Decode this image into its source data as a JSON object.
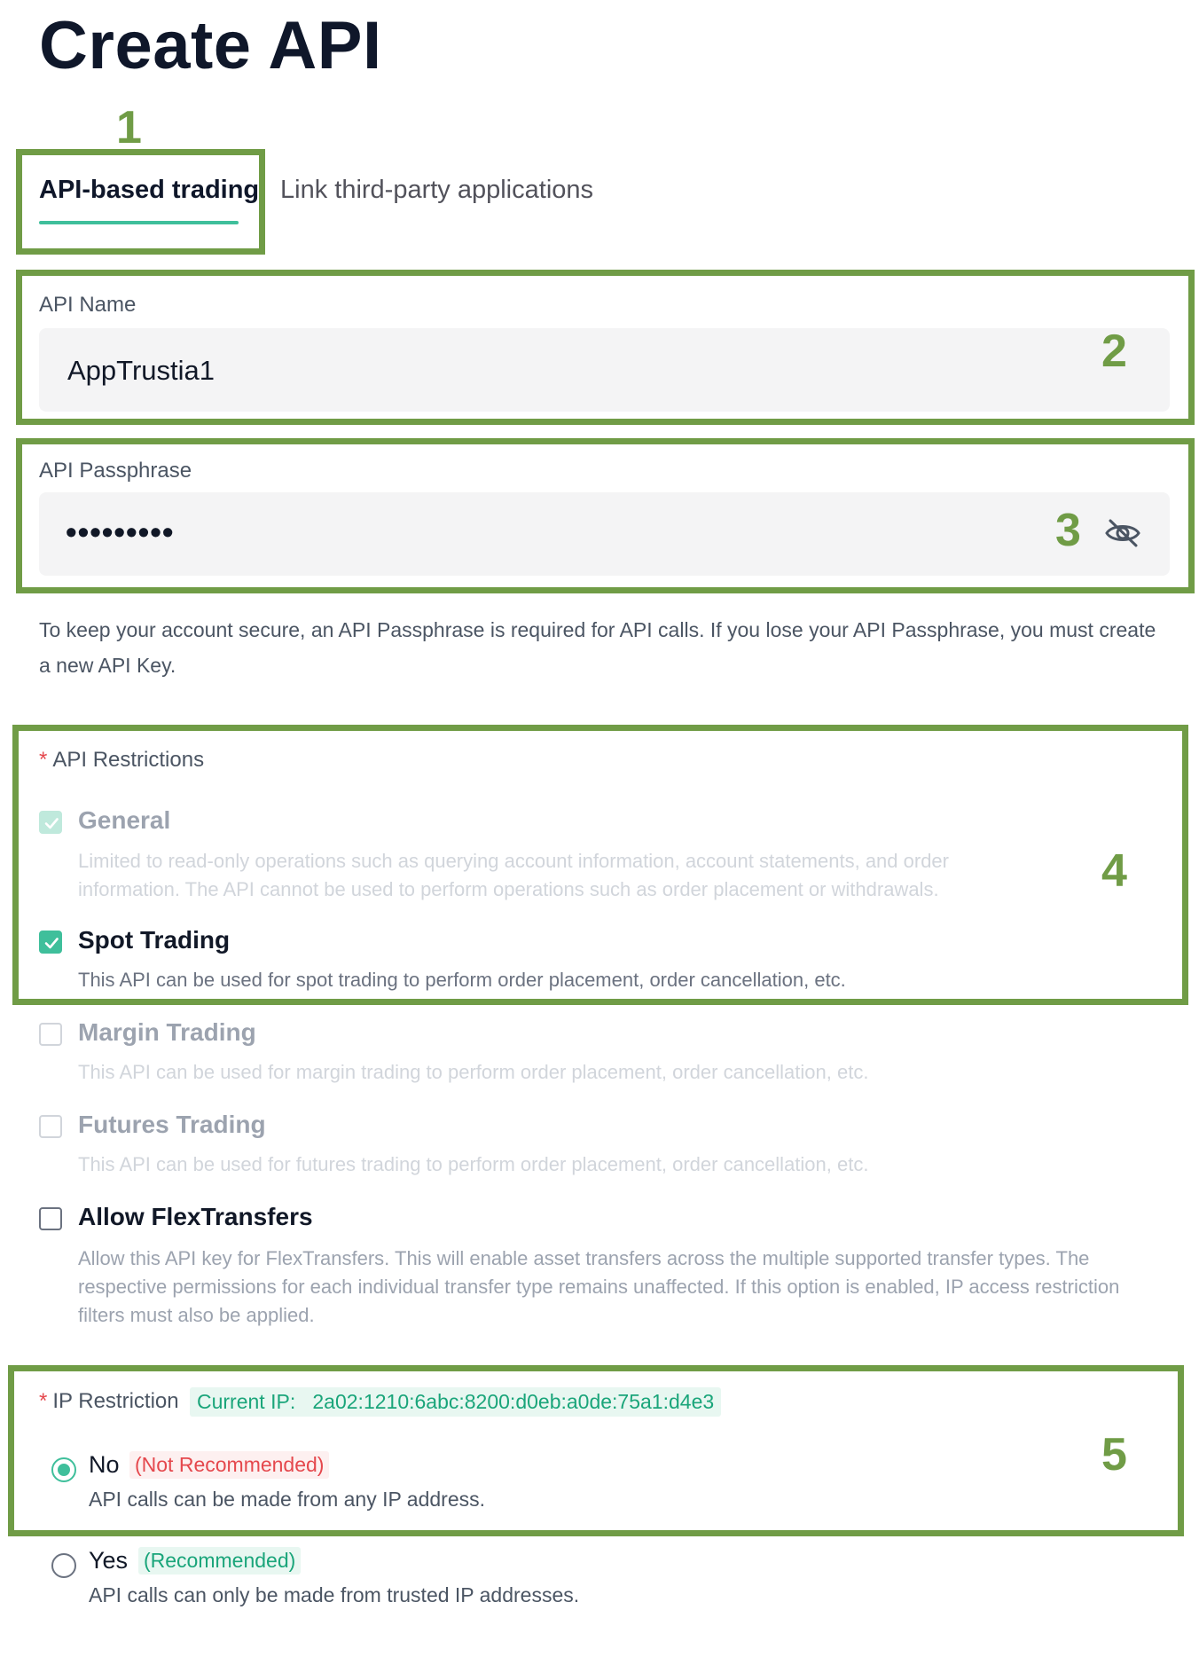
{
  "page": {
    "title": "Create API"
  },
  "tabs": [
    {
      "label": "API-based trading",
      "active": true
    },
    {
      "label": "Link third-party applications",
      "active": false
    }
  ],
  "annotations": [
    "1",
    "2",
    "3",
    "4",
    "5"
  ],
  "api_name": {
    "label": "API Name",
    "value": "AppTrustia1"
  },
  "api_passphrase": {
    "label": "API Passphrase",
    "value_masked": "•••••••••",
    "toggle_icon": "eye-slash-icon",
    "helper": "To keep your account secure, an API Passphrase is required for API calls. If you lose your API Passphrase, you must create a new API Key."
  },
  "api_restrictions": {
    "required_mark": "*",
    "label": "API Restrictions",
    "options": [
      {
        "title": "General",
        "description": "Limited to read-only operations such as querying account information, account statements, and order information. The API cannot be used to perform operations such as order placement or withdrawals.",
        "checked": true,
        "disabled": true
      },
      {
        "title": "Spot Trading",
        "description": "This API can be used for spot trading to perform order placement, order cancellation, etc.",
        "checked": true,
        "disabled": false
      },
      {
        "title": "Margin Trading",
        "description": "This API can be used for margin trading to perform order placement, order cancellation, etc.",
        "checked": false,
        "disabled": true
      },
      {
        "title": "Futures Trading",
        "description": "This API can be used for futures trading to perform order placement, order cancellation, etc.",
        "checked": false,
        "disabled": true
      },
      {
        "title": "Allow FlexTransfers",
        "description": "Allow this API key for FlexTransfers. This will enable asset transfers across the multiple supported transfer types. The respective permissions for each individual transfer type remains unaffected. If this option is enabled, IP access restriction filters must also be applied.",
        "checked": false,
        "disabled": false
      }
    ]
  },
  "ip_restriction": {
    "required_mark": "*",
    "label": "IP Restriction",
    "current_ip_label": "Current IP:",
    "current_ip": "2a02:1210:6abc:8200:d0eb:a0de:75a1:d4e3",
    "options": [
      {
        "title": "No",
        "tag": "(Not Recommended)",
        "description": "API calls can be made from any IP address.",
        "selected": true
      },
      {
        "title": "Yes",
        "tag": "(Recommended)",
        "description": "API calls can only be made from trusted IP addresses.",
        "selected": false
      }
    ]
  },
  "colors": {
    "accent": "#3fbf9b",
    "annotation": "#709c46",
    "danger": "#e5484d"
  }
}
